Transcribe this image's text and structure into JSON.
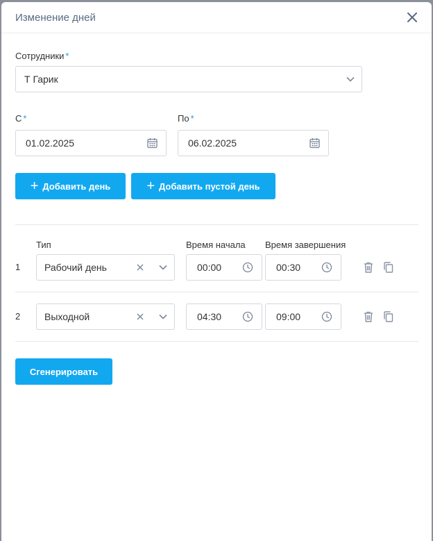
{
  "dialog": {
    "title": "Изменение дней"
  },
  "employees": {
    "label": "Сотрудники",
    "required_mark": "*",
    "value": "Т Гарик"
  },
  "date_from": {
    "label": "С",
    "required_mark": "*",
    "value": "01.02.2025"
  },
  "date_to": {
    "label": "По",
    "required_mark": "*",
    "value": "06.02.2025"
  },
  "buttons": {
    "add_day": "Добавить день",
    "add_empty_day": "Добавить пустой день",
    "generate": "Сгенерировать",
    "plus": "+"
  },
  "table": {
    "headers": {
      "type": "Тип",
      "start": "Время начала",
      "end": "Время завершения"
    },
    "rows": [
      {
        "num": "1",
        "type": "Рабочий день",
        "start": "00:00",
        "end": "00:30"
      },
      {
        "num": "2",
        "type": "Выходной",
        "start": "04:30",
        "end": "09:00"
      }
    ]
  },
  "colors": {
    "accent": "#12a8f0",
    "required": "#1a9fe0",
    "icon": "#7a8699"
  },
  "icons": [
    "close-icon",
    "chevron-down-icon",
    "calendar-icon",
    "clock-icon",
    "clear-icon",
    "trash-icon",
    "copy-icon",
    "plus-icon"
  ]
}
